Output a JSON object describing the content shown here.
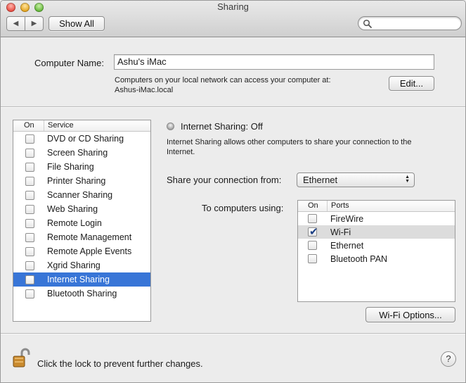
{
  "window": {
    "title": "Sharing"
  },
  "toolbar": {
    "back_glyph": "◀",
    "forward_glyph": "▶",
    "show_all_label": "Show All",
    "search_placeholder": ""
  },
  "computer_name": {
    "label": "Computer Name:",
    "value": "Ashu's iMac",
    "info_line1": "Computers on your local network can access your computer at:",
    "info_line2": "Ashus-iMac.local",
    "edit_label": "Edit..."
  },
  "services": {
    "header_on": "On",
    "header_service": "Service",
    "items": [
      {
        "label": "DVD or CD Sharing",
        "checked": false
      },
      {
        "label": "Screen Sharing",
        "checked": false
      },
      {
        "label": "File Sharing",
        "checked": false
      },
      {
        "label": "Printer Sharing",
        "checked": false
      },
      {
        "label": "Scanner Sharing",
        "checked": false
      },
      {
        "label": "Web Sharing",
        "checked": false
      },
      {
        "label": "Remote Login",
        "checked": false
      },
      {
        "label": "Remote Management",
        "checked": false
      },
      {
        "label": "Remote Apple Events",
        "checked": false
      },
      {
        "label": "Xgrid Sharing",
        "checked": false
      },
      {
        "label": "Internet Sharing",
        "checked": false,
        "selected": true
      },
      {
        "label": "Bluetooth Sharing",
        "checked": false
      }
    ]
  },
  "detail": {
    "status_title": "Internet Sharing: Off",
    "description_line1": "Internet Sharing allows other computers to share your connection to the",
    "description_line2": "Internet.",
    "share_from_label": "Share your connection from:",
    "share_from_value": "Ethernet",
    "to_computers_label": "To computers using:",
    "ports_header_on": "On",
    "ports_header_ports": "Ports",
    "ports": [
      {
        "label": "FireWire",
        "checked": false
      },
      {
        "label": "Wi-Fi",
        "checked": true,
        "highlight": true
      },
      {
        "label": "Ethernet",
        "checked": false
      },
      {
        "label": "Bluetooth PAN",
        "checked": false
      }
    ],
    "wifi_options_label": "Wi-Fi Options..."
  },
  "footer": {
    "lock_text": "Click the lock to prevent further changes.",
    "help_glyph": "?"
  },
  "colors": {
    "selection": "#3875d7",
    "check_mark": "#1c3f84",
    "window_bg": "#ececec"
  }
}
